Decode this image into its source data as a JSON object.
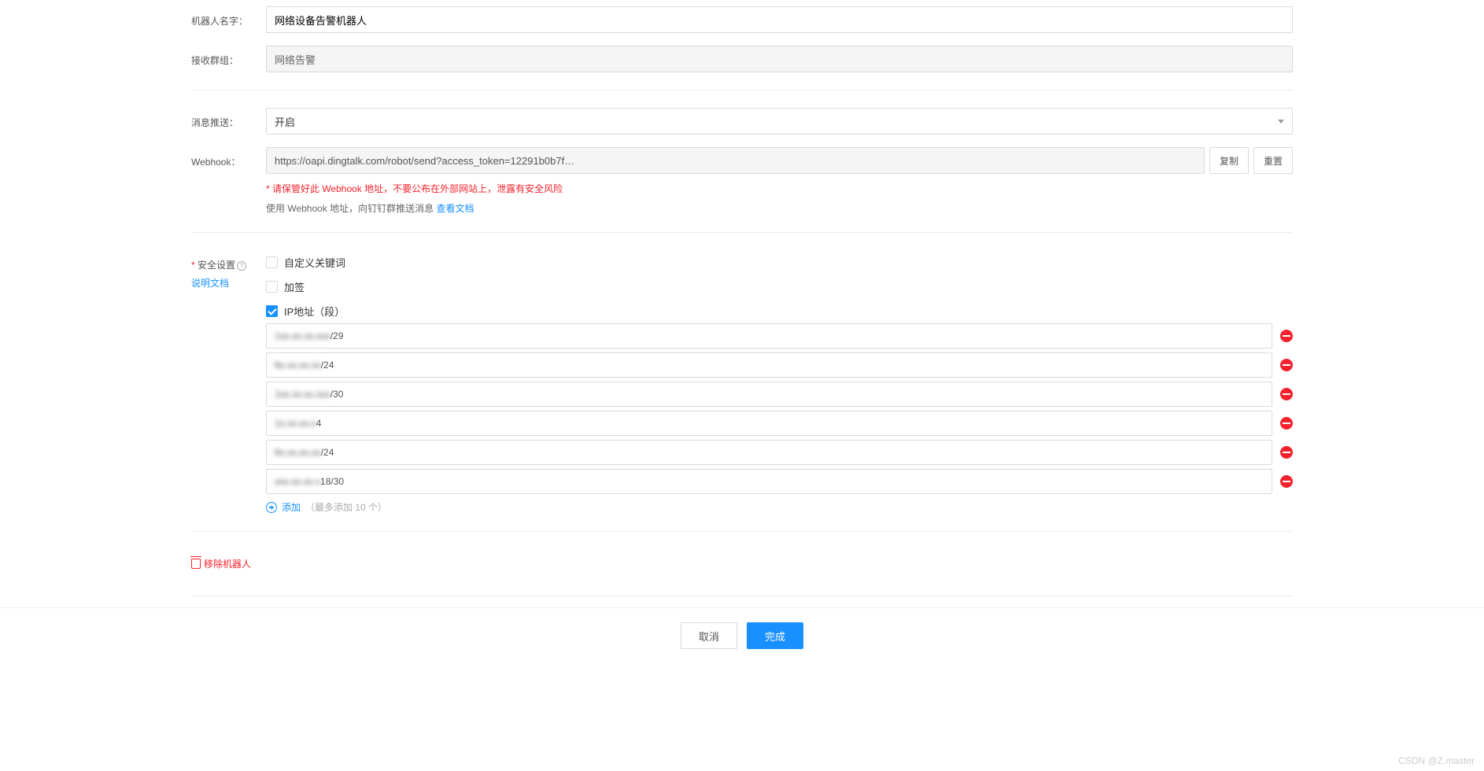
{
  "fields": {
    "robot_name_label": "机器人名字：",
    "robot_name_value": "网络设备告警机器人",
    "group_label": "接收群组：",
    "group_value": "网络告警",
    "push_label": "消息推送：",
    "push_value": "开启",
    "webhook_label": "Webhook：",
    "webhook_value": "https://oapi.dingtalk.com/robot/send?access_token=12291b0b7f…",
    "copy_btn": "复制",
    "reset_btn": "重置",
    "warn": "* 请保管好此 Webhook 地址，不要公布在外部网站上，泄露有安全风险",
    "help_prefix": "使用 Webhook 地址，向钉钉群推送消息 ",
    "help_link": "查看文档"
  },
  "security": {
    "label": "安全设置",
    "doc_link": "说明文档",
    "opt_keyword": "自定义关键词",
    "opt_sign": "加签",
    "opt_ip": "IP地址（段）",
    "ips": [
      {
        "masked": "1xx.xx.xx.xxx",
        "suffix": "/29"
      },
      {
        "masked": "6x.xx.xx.xx",
        "suffix": "/24"
      },
      {
        "masked": "1xx.xx.xx.xxx",
        "suffix": "/30"
      },
      {
        "masked": "1x.xx.xx.x",
        "suffix": "4"
      },
      {
        "masked": "6x.xx.xx.xx",
        "suffix": "/24"
      },
      {
        "masked": "xxx.xx.xx.x",
        "suffix": "18/30"
      }
    ],
    "add_label": "添加",
    "limit": "（最多添加 10 个）"
  },
  "actions": {
    "delete_robot": "移除机器人",
    "cancel": "取消",
    "submit": "完成"
  },
  "watermark": "CSDN @Z.master"
}
